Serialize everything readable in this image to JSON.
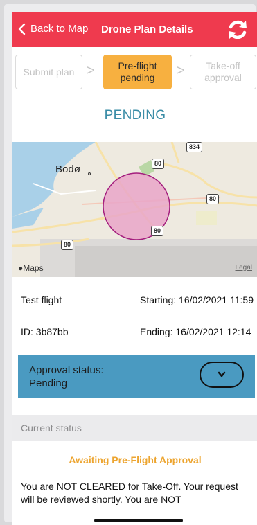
{
  "header": {
    "back_label": "Back to Map",
    "title": "Drone Plan Details",
    "color": "#ef3a4e"
  },
  "steps": [
    {
      "label": "Submit plan",
      "state": "inactive"
    },
    {
      "label": "Pre-flight pending",
      "state": "active"
    },
    {
      "label": "Take-off approval",
      "state": "inactive"
    }
  ],
  "status_heading": "PENDING",
  "map": {
    "city": "Bodø",
    "road_labels": [
      "834",
      "80",
      "80",
      "80",
      "80"
    ],
    "attribution": "Maps",
    "legal": "Legal"
  },
  "flight": {
    "name": "Test flight",
    "id": "ID: 3b87bb",
    "starting": "Starting: 16/02/2021 11:59",
    "ending": "Ending: 16/02/2021 12:14"
  },
  "approval": {
    "text": "Approval status: Pending",
    "color": "#4a9ac1"
  },
  "current_status": {
    "label": "Current status",
    "headline": "Awaiting Pre-Flight Approval",
    "message": "You are NOT CLEARED for Take-Off. Your request will be reviewed shortly. You are NOT"
  },
  "icons": {
    "back": "chevron-left-icon",
    "refresh": "refresh-icon",
    "expand": "chevron-down-icon",
    "apple": "apple-icon"
  }
}
